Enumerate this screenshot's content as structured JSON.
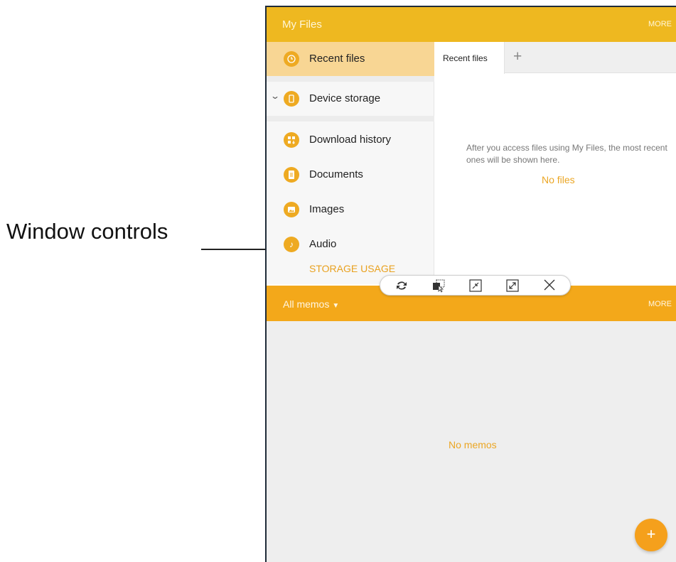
{
  "callout": {
    "label": "Window controls"
  },
  "my_files": {
    "title": "My Files",
    "more_label": "MORE",
    "sidebar": {
      "items": [
        {
          "label": "Recent files",
          "icon": "clock-icon",
          "active": true
        },
        {
          "label": "Device storage",
          "icon": "phone-icon",
          "expand": "chevron-down-icon"
        },
        {
          "label": "Download history",
          "icon": "download-history-icon"
        },
        {
          "label": "Documents",
          "icon": "document-icon"
        },
        {
          "label": "Images",
          "icon": "image-icon"
        },
        {
          "label": "Audio",
          "icon": "music-note-icon"
        }
      ],
      "storage_label": "STORAGE USAGE"
    },
    "tabs": [
      {
        "label": "Recent files"
      }
    ],
    "empty_message": "After you access files using My Files, the most recent ones will be shown here.",
    "no_files": "No files"
  },
  "window_controls": [
    {
      "name": "switch-windows",
      "icon": "swap-icon"
    },
    {
      "name": "drag-and-drop",
      "icon": "drag-content-icon"
    },
    {
      "name": "minimize-window",
      "icon": "minimize-icon"
    },
    {
      "name": "maximize-window",
      "icon": "maximize-icon"
    },
    {
      "name": "close-window",
      "icon": "close-icon"
    }
  ],
  "memo": {
    "title": "All memos",
    "more_label": "MORE",
    "empty": "No memos"
  },
  "colors": {
    "my_files_header": "#eeb820",
    "memo_header": "#f3a81a",
    "accent": "#eba624",
    "active_item": "#f8d694"
  }
}
